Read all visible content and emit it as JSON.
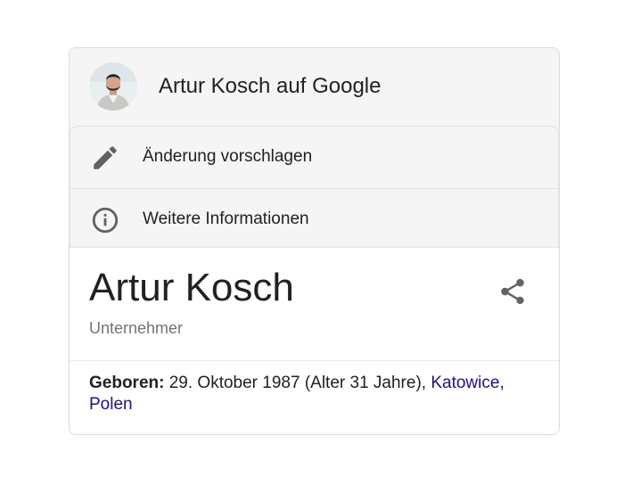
{
  "header": {
    "title": "Artur Kosch auf Google"
  },
  "actions": [
    {
      "label": "Änderung vorschlagen",
      "icon": "pencil-icon"
    },
    {
      "label": "Weitere Informationen",
      "icon": "info-icon"
    }
  ],
  "entity": {
    "name": "Artur Kosch",
    "subtitle": "Unternehmer"
  },
  "facts": {
    "born_label": "Geboren:",
    "born_value": " 29. Oktober 1987 (Alter 31 Jahre), ",
    "born_place_city": "Katowice,",
    "born_place_country": "Polen"
  },
  "colors": {
    "link": "#1a0dab",
    "text": "#202124",
    "muted": "#70757a",
    "panel_bg": "#f5f5f5"
  }
}
